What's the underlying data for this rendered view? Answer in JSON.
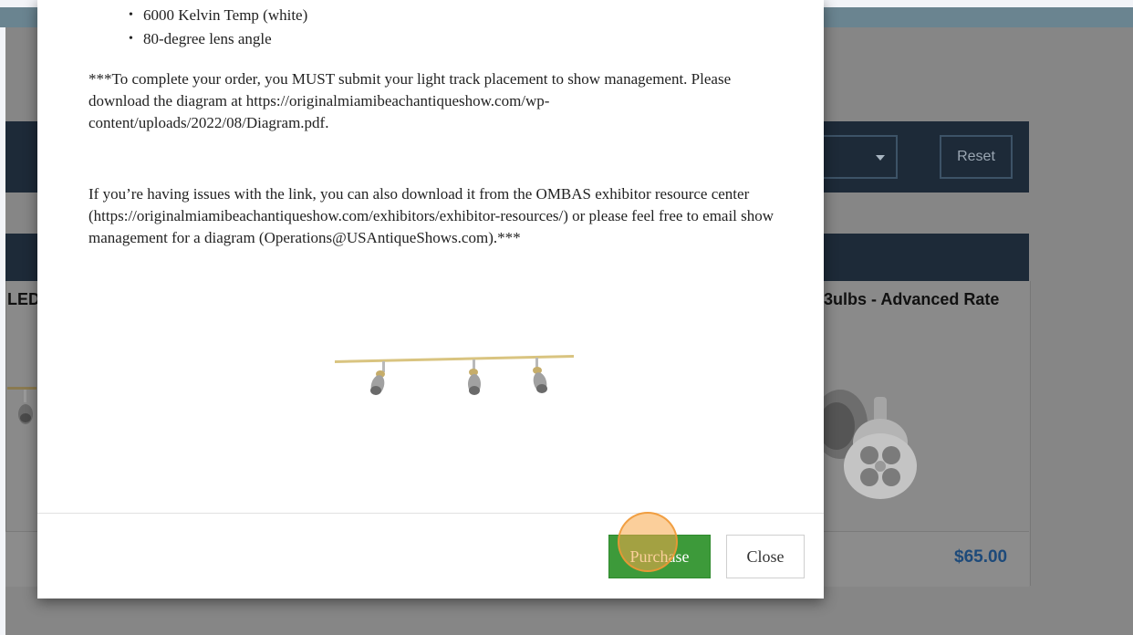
{
  "background": {
    "filter_reset_label": "Reset",
    "card_left_title": "LED",
    "card_right_title": "3ulbs - Advanced Rate",
    "card_right_price": "$65.00"
  },
  "modal": {
    "spec_items": [
      "6000 Kelvin Temp (white)",
      "80-degree lens angle"
    ],
    "paragraph_1": "***To complete your order, you MUST submit your light track placement to show management. Please download the diagram at https://originalmiamibeachantiqueshow.com/wp-content/uploads/2022/08/Diagram.pdf.",
    "paragraph_2": "If you’re having issues with the link, you can also download it from the OMBAS exhibitor resource center (https://originalmiamibeachantiqueshow.com/exhibitors/exhibitor-resources/) or please feel free to email show management for a diagram (Operations@USAntiqueShows.com).***",
    "purchase_label": "Purchase",
    "close_label": "Close"
  },
  "colors": {
    "purchase_green": "#3d9a3a",
    "toolbar_navy": "#1d2a38",
    "price_blue": "#1d4a7a"
  }
}
